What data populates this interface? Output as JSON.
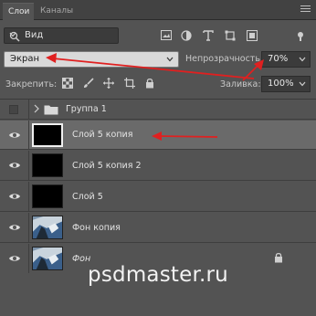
{
  "tabs": [
    {
      "label": "Слои",
      "active": true
    },
    {
      "label": "Каналы",
      "active": false
    }
  ],
  "filter": {
    "label": "Вид"
  },
  "blend_mode": {
    "value": "Экран"
  },
  "opacity": {
    "label": "Непрозрачность:",
    "value": "70%"
  },
  "lock": {
    "label": "Закрепить:"
  },
  "fill": {
    "label": "Заливка:",
    "value": "100%"
  },
  "layers": [
    {
      "name": "Группа 1",
      "type": "group"
    },
    {
      "name": "Слой 5 копия",
      "selected": true
    },
    {
      "name": "Слой 5 копия 2",
      "selected": false
    },
    {
      "name": "Слой 5",
      "selected": false
    },
    {
      "name": "Фон копия",
      "selected": false
    },
    {
      "name": "Фон",
      "selected": false,
      "locked": true
    }
  ],
  "watermark": "psdmaster.ru",
  "colors": {
    "panel": "#535353",
    "tabbar": "#424242",
    "selected_row": "#6a6a6a",
    "annotation_arrow": "#e02020"
  }
}
